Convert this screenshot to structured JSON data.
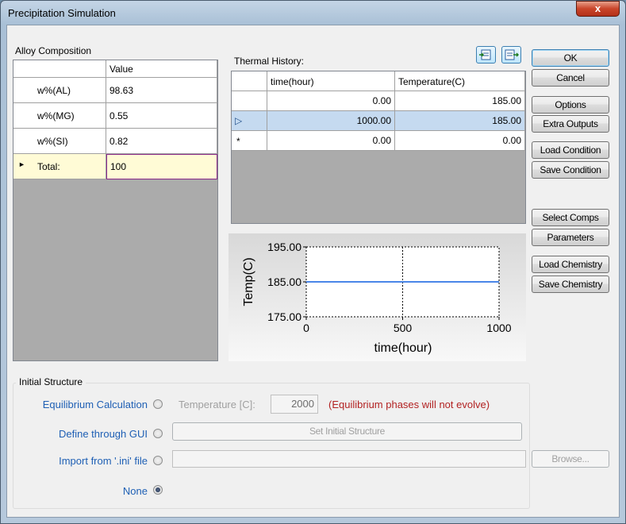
{
  "window": {
    "title": "Precipitation Simulation",
    "close_glyph": "x"
  },
  "alloy": {
    "label": "Alloy Composition",
    "value_header": "Value",
    "rows": [
      {
        "name": "w%(AL)",
        "value": "98.63"
      },
      {
        "name": "w%(MG)",
        "value": "0.55"
      },
      {
        "name": "w%(SI)",
        "value": "0.82"
      }
    ],
    "total_label": "Total:",
    "total_value": "100",
    "total_marker": "►"
  },
  "thermal": {
    "label": "Thermal History:",
    "col_time": "time(hour)",
    "col_temp": "Temperature(C)",
    "rows": [
      {
        "marker": "",
        "time": "0.00",
        "temp": "185.00"
      },
      {
        "marker": "▷",
        "time": "1000.00",
        "temp": "185.00"
      },
      {
        "marker": "*",
        "time": "0.00",
        "temp": "0.00"
      }
    ],
    "import_icon": "import-table-icon",
    "export_icon": "export-table-icon"
  },
  "chart_data": {
    "type": "line",
    "xlabel": "time(hour)",
    "ylabel": "Temp(C)",
    "xlim": [
      0,
      1000
    ],
    "ylim": [
      175,
      195
    ],
    "x_ticks": [
      "0",
      "500",
      "1000"
    ],
    "y_ticks": [
      "195.00",
      "185.00",
      "175.00"
    ],
    "x": [
      0,
      1000
    ],
    "y": [
      185,
      185
    ],
    "line_color": "#4a86e8"
  },
  "buttons": {
    "ok": "OK",
    "cancel": "Cancel",
    "options": "Options",
    "extra_outputs": "Extra Outputs",
    "load_condition": "Load Condition",
    "save_condition": "Save Condition",
    "select_comps": "Select Comps",
    "parameters": "Parameters",
    "load_chemistry": "Load Chemistry",
    "save_chemistry": "Save Chemistry"
  },
  "initial": {
    "label": "Initial Structure",
    "eq_label": "Equilibrium Calculation",
    "temp_label": "Temperature [C]:",
    "temp_value": "2000",
    "warning": "(Equilibrium phases will not evolve)",
    "gui_label": "Define through GUI",
    "gui_button": "Set Initial Structure",
    "ini_label": "Import from '.ini' file",
    "browse": "Browse...",
    "none_label": "None",
    "selected": "none"
  }
}
